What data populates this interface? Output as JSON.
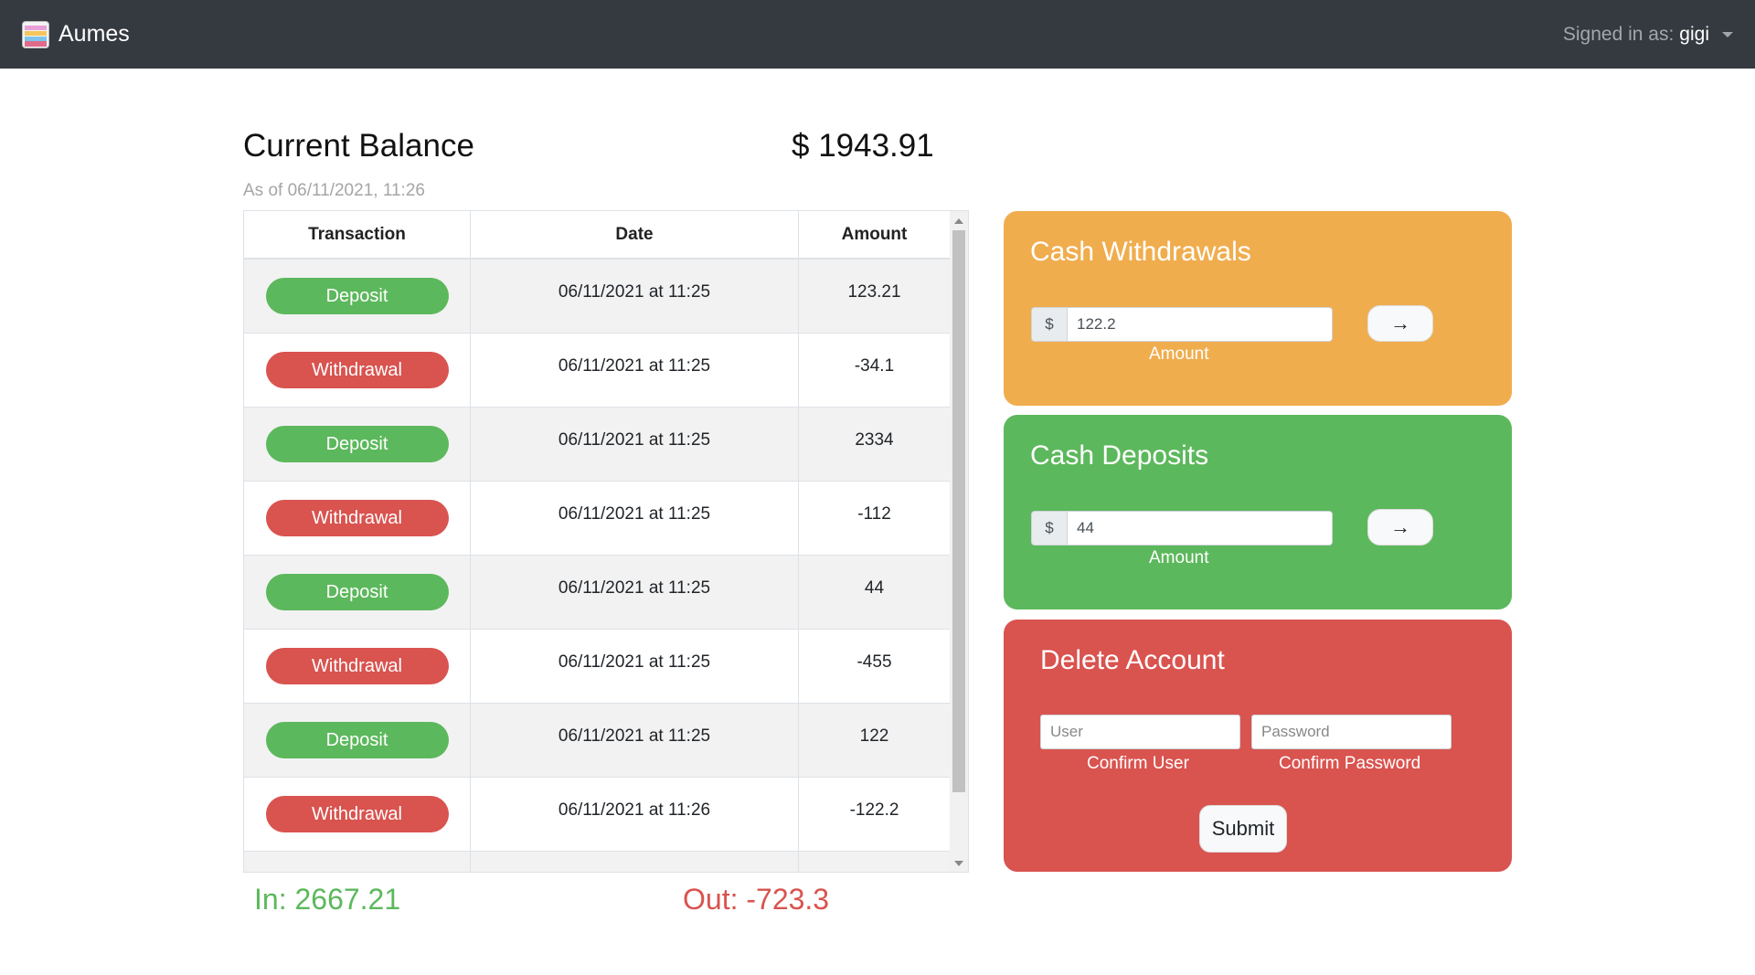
{
  "navbar": {
    "brand": "Aumes",
    "brand_icon": "wallet-icon",
    "signed_in_label": "Signed in as:",
    "username": "gigi"
  },
  "balance": {
    "title": "Current Balance",
    "value": "$ 1943.91",
    "as_of": "As of 06/11/2021, 11:26"
  },
  "table": {
    "headers": [
      "Transaction",
      "Date",
      "Amount"
    ],
    "rows": [
      {
        "type": "Deposit",
        "date": "06/11/2021 at 11:25",
        "amount": "123.21"
      },
      {
        "type": "Withdrawal",
        "date": "06/11/2021 at 11:25",
        "amount": "-34.1"
      },
      {
        "type": "Deposit",
        "date": "06/11/2021 at 11:25",
        "amount": "2334"
      },
      {
        "type": "Withdrawal",
        "date": "06/11/2021 at 11:25",
        "amount": "-112"
      },
      {
        "type": "Deposit",
        "date": "06/11/2021 at 11:25",
        "amount": "44"
      },
      {
        "type": "Withdrawal",
        "date": "06/11/2021 at 11:25",
        "amount": "-455"
      },
      {
        "type": "Deposit",
        "date": "06/11/2021 at 11:25",
        "amount": "122"
      },
      {
        "type": "Withdrawal",
        "date": "06/11/2021 at 11:26",
        "amount": "-122.2"
      }
    ]
  },
  "totals": {
    "in": "In: 2667.21",
    "out": "Out: -723.3"
  },
  "withdrawals": {
    "title": "Cash Withdrawals",
    "currency": "$",
    "value": "122.2",
    "label": "Amount",
    "submit_icon": "arrow-right-icon",
    "arrow": "→"
  },
  "deposits": {
    "title": "Cash Deposits",
    "currency": "$",
    "value": "44",
    "label": "Amount",
    "submit_icon": "arrow-right-icon",
    "arrow": "→"
  },
  "delete_account": {
    "title": "Delete Account",
    "user_placeholder": "User",
    "password_placeholder": "Password",
    "user_label": "Confirm User",
    "password_label": "Confirm Password",
    "submit": "Submit"
  },
  "colors": {
    "navbar": "#343a40",
    "deposit": "#5cb85c",
    "withdrawal": "#d9534f",
    "withdraw_card": "#f0ad4e"
  }
}
